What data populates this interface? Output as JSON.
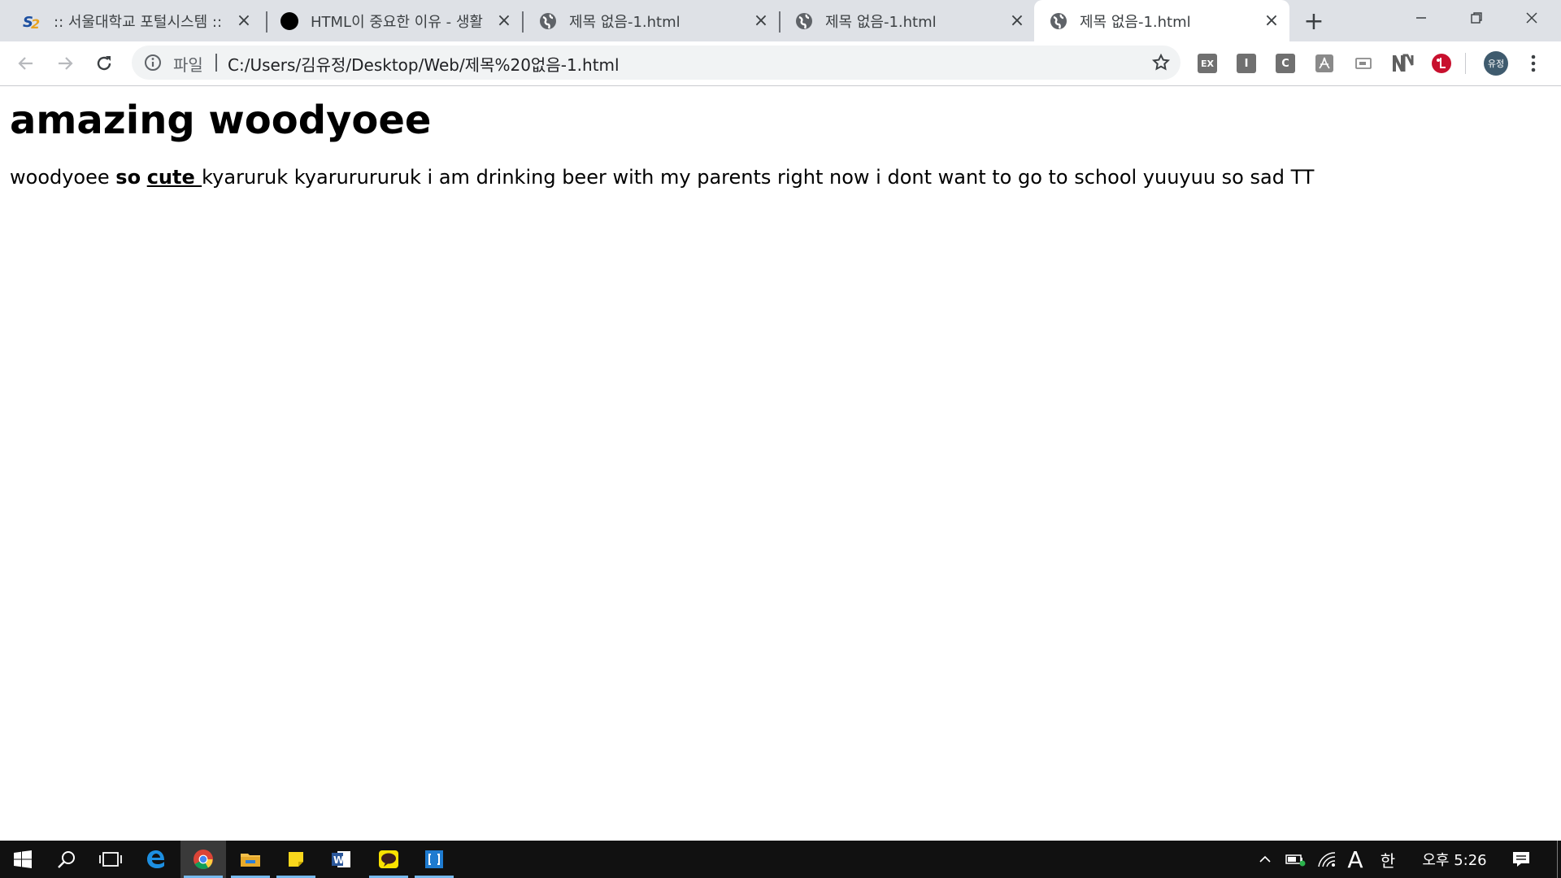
{
  "browser": {
    "tabs": [
      {
        "title": ":: 서울대학교 포털시스템 ::",
        "icon": "snu-logo-icon",
        "active": false
      },
      {
        "title": "HTML이 중요한 이유 - 생활",
        "icon": "black-circle-icon",
        "active": false
      },
      {
        "title": "제목 없음-1.html",
        "icon": "globe-icon",
        "active": false
      },
      {
        "title": "제목 없음-1.html",
        "icon": "globe-icon",
        "active": false
      },
      {
        "title": "제목 없음-1.html",
        "icon": "globe-icon",
        "active": true
      }
    ],
    "new_tab_label": "+",
    "omnibox": {
      "scheme_label": "파일",
      "url": "C:/Users/김유정/Desktop/Web/제목%20없음-1.html"
    },
    "profile_label": "유정",
    "extensions": [
      "EX",
      "I",
      "C",
      "pdf-icon",
      "cast-icon",
      "naver-icon",
      "lg-icon"
    ]
  },
  "page": {
    "heading": "amazing woodyoee",
    "para_start": "woodyoee ",
    "para_bold": "so",
    "para_link": "cute ",
    "para_end": "kyaruruk kyarurururuk i am drinking beer with my parents right now i dont want to go to school yuuyuu so sad TT"
  },
  "taskbar": {
    "apps": [
      "windows-start-icon",
      "search-icon",
      "task-view-icon",
      "edge-icon",
      "chrome-icon",
      "file-explorer-icon",
      "sticky-notes-icon",
      "word-icon",
      "kakaotalk-icon",
      "brackets-icon"
    ],
    "ime_a": "A",
    "ime_lang": "한",
    "clock": "오후 5:26"
  },
  "colors": {
    "tabbar": "#dee1e6",
    "taskbar": "#111111",
    "accent": "#76b9ed"
  }
}
